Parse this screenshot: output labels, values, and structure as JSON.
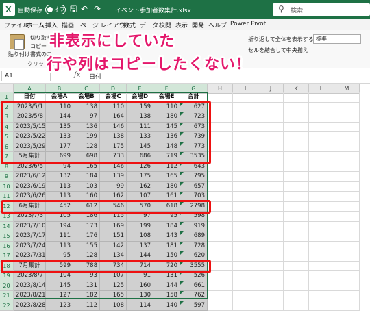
{
  "colors": {
    "excel_green": "#1e7145",
    "highlight_red": "#e11111",
    "caption_pink": "#e4176b",
    "cell_gray": "#d0d0d0"
  },
  "titlebar": {
    "autosave_label": "自動保存",
    "autosave_state": "オフ",
    "filename": "イベント参加者数集計.xlsx",
    "search_placeholder": "検索",
    "icons": [
      "excel-logo-icon",
      "save-icon",
      "undo-icon",
      "redo-icon",
      "search-icon"
    ]
  },
  "ribbon_tabs": [
    "ファイル",
    "ホーム",
    "挿入",
    "描画",
    "ページ レイアウト",
    "数式",
    "データ",
    "校閲",
    "表示",
    "開発",
    "ヘルプ",
    "Power Pivot"
  ],
  "active_tab": "ホーム",
  "ribbon": {
    "paste": "貼り付け",
    "cut": "切り取り",
    "copy": "コピー",
    "format_painter": "書式のコ",
    "clipboard_group": "クリップボー",
    "wrap_text": "折り返して全体を表示する",
    "merge_center": "セルを結合して中央揃え",
    "number_format": "標準"
  },
  "formula_bar": {
    "name_box": "A1",
    "fx": "fx",
    "value": "日付"
  },
  "columns": [
    "A",
    "B",
    "C",
    "D",
    "E",
    "F",
    "G",
    "H",
    "I",
    "J",
    "K",
    "L",
    "M"
  ],
  "row_numbers": [
    "1",
    "2",
    "3",
    "4",
    "5",
    "6",
    "7",
    "8",
    "9",
    "10",
    "11",
    "12",
    "13",
    "14",
    "15",
    "16",
    "17",
    "18",
    "19",
    "20",
    "21",
    "22"
  ],
  "table": {
    "headers": [
      "日付",
      "会場A",
      "会場B",
      "会場C",
      "会場D",
      "会場E",
      "合計"
    ],
    "rows": [
      [
        "2023/5/1",
        "110",
        "138",
        "110",
        "159",
        "110",
        "627"
      ],
      [
        "2023/5/8",
        "144",
        "97",
        "164",
        "138",
        "180",
        "723"
      ],
      [
        "2023/5/15",
        "135",
        "136",
        "146",
        "111",
        "145",
        "673"
      ],
      [
        "2023/5/22",
        "133",
        "199",
        "138",
        "133",
        "136",
        "739"
      ],
      [
        "2023/5/29",
        "177",
        "128",
        "175",
        "145",
        "148",
        "773"
      ],
      [
        "5月集計",
        "699",
        "698",
        "733",
        "686",
        "719",
        "3535"
      ],
      [
        "2023/6/5",
        "94",
        "165",
        "146",
        "126",
        "112",
        "643"
      ],
      [
        "2023/6/12",
        "132",
        "184",
        "139",
        "175",
        "165",
        "795"
      ],
      [
        "2023/6/19",
        "113",
        "103",
        "99",
        "162",
        "180",
        "657"
      ],
      [
        "2023/6/26",
        "113",
        "160",
        "162",
        "107",
        "161",
        "703"
      ],
      [
        "6月集計",
        "452",
        "612",
        "546",
        "570",
        "618",
        "2798"
      ],
      [
        "2023/7/3",
        "105",
        "186",
        "115",
        "97",
        "95",
        "598"
      ],
      [
        "2023/7/10",
        "194",
        "173",
        "169",
        "199",
        "184",
        "919"
      ],
      [
        "2023/7/17",
        "111",
        "176",
        "151",
        "108",
        "143",
        "689"
      ],
      [
        "2023/7/24",
        "113",
        "155",
        "142",
        "137",
        "181",
        "728"
      ],
      [
        "2023/7/31",
        "95",
        "128",
        "134",
        "144",
        "150",
        "620"
      ],
      [
        "7月集計",
        "599",
        "788",
        "734",
        "714",
        "720",
        "3555"
      ],
      [
        "2023/8/7",
        "104",
        "93",
        "107",
        "91",
        "131",
        "526"
      ],
      [
        "2023/8/14",
        "145",
        "131",
        "125",
        "160",
        "144",
        "661"
      ],
      [
        "2023/8/21",
        "127",
        "182",
        "165",
        "130",
        "158",
        "762"
      ],
      [
        "2023/8/28",
        "123",
        "112",
        "108",
        "114",
        "140",
        "597"
      ]
    ]
  },
  "caption": {
    "line1": "非表示にしていた",
    "line2": "行や列はコピーしたくない！"
  }
}
